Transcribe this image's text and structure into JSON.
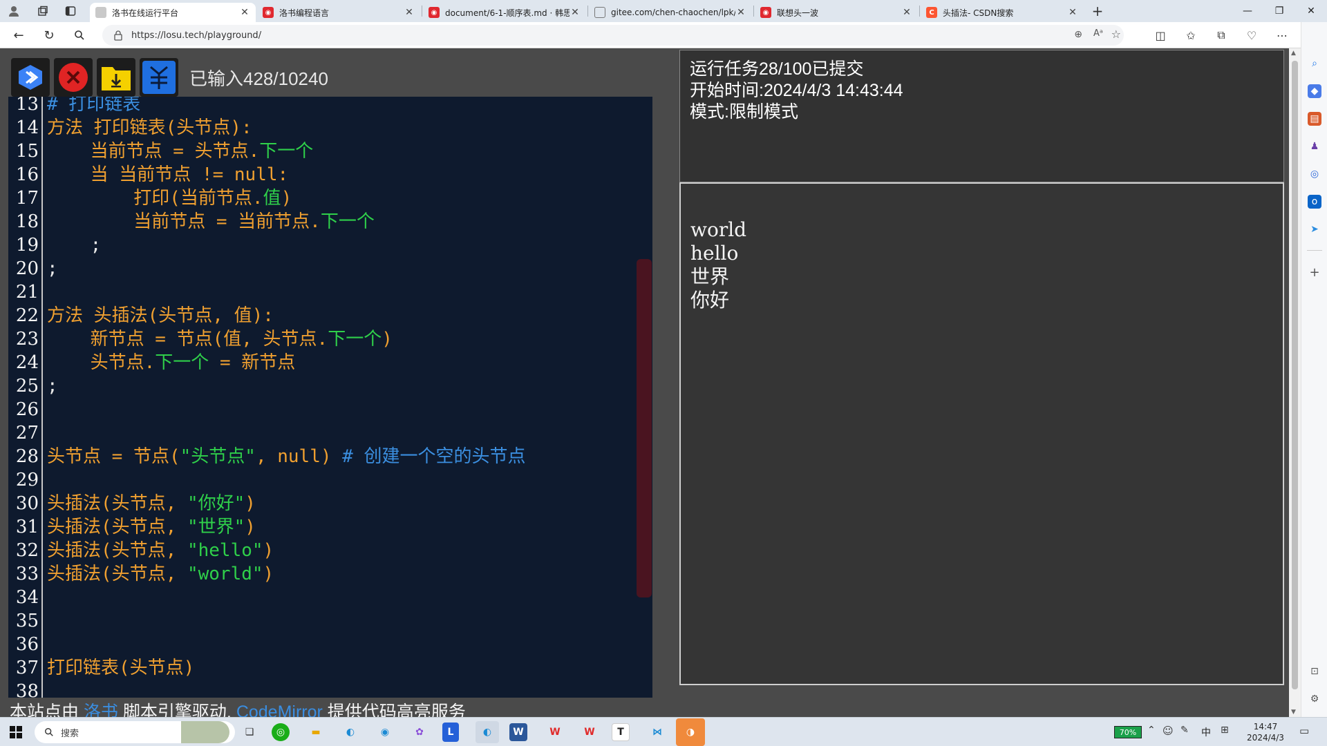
{
  "browser": {
    "tabs": [
      {
        "title": "洛书在线运行平台",
        "active": true,
        "favicon": "page-icon"
      },
      {
        "title": "洛书编程语言",
        "active": false,
        "favicon": "weibo-icon"
      },
      {
        "title": "document/6-1-顺序表.md · 韩思",
        "active": false,
        "favicon": "weibo-icon"
      },
      {
        "title": "gitee.com/chen-chaochen/lpk/ra",
        "active": false,
        "favicon": "doc-icon"
      },
      {
        "title": "联想头一波",
        "active": false,
        "favicon": "weibo-icon"
      },
      {
        "title": "头插法- CSDN搜索",
        "active": false,
        "favicon": "csdn-icon"
      }
    ],
    "url": "https://losu.tech/playground/"
  },
  "toolbar": {
    "counter_text": "已输入428/10240"
  },
  "editor": {
    "lines": [
      {
        "n": "13",
        "tokens": [
          {
            "t": "# 打印链表",
            "c": "cm"
          }
        ]
      },
      {
        "n": "14",
        "tokens": [
          {
            "t": "方法 打印链表(头节点):",
            "c": "kw"
          }
        ]
      },
      {
        "n": "15",
        "tokens": [
          {
            "t": "    当前节点 = 头节点.",
            "c": "id"
          },
          {
            "t": "下一个",
            "c": "pr"
          }
        ]
      },
      {
        "n": "16",
        "tokens": [
          {
            "t": "    当 当前节点 != ",
            "c": "id"
          },
          {
            "t": "null",
            "c": "nu"
          },
          {
            "t": ":",
            "c": "id"
          }
        ]
      },
      {
        "n": "17",
        "tokens": [
          {
            "t": "        打印(当前节点.",
            "c": "id"
          },
          {
            "t": "值",
            "c": "pr"
          },
          {
            "t": ")",
            "c": "id"
          }
        ]
      },
      {
        "n": "18",
        "tokens": [
          {
            "t": "        当前节点 = 当前节点.",
            "c": "id"
          },
          {
            "t": "下一个",
            "c": "pr"
          }
        ]
      },
      {
        "n": "19",
        "tokens": [
          {
            "t": "    ;",
            "c": "op"
          }
        ]
      },
      {
        "n": "20",
        "tokens": [
          {
            "t": ";",
            "c": "op"
          }
        ]
      },
      {
        "n": "21",
        "tokens": []
      },
      {
        "n": "22",
        "tokens": [
          {
            "t": "方法 头插法(头节点, 值):",
            "c": "kw"
          }
        ]
      },
      {
        "n": "23",
        "tokens": [
          {
            "t": "    新节点 = 节点(值, 头节点.",
            "c": "id"
          },
          {
            "t": "下一个",
            "c": "pr"
          },
          {
            "t": ")",
            "c": "id"
          }
        ]
      },
      {
        "n": "24",
        "tokens": [
          {
            "t": "    头节点.",
            "c": "id"
          },
          {
            "t": "下一个",
            "c": "pr"
          },
          {
            "t": " = 新节点",
            "c": "id"
          }
        ]
      },
      {
        "n": "25",
        "tokens": [
          {
            "t": ";",
            "c": "op"
          }
        ]
      },
      {
        "n": "26",
        "tokens": []
      },
      {
        "n": "27",
        "tokens": []
      },
      {
        "n": "28",
        "tokens": [
          {
            "t": "头节点 = 节点(",
            "c": "id"
          },
          {
            "t": "\"头节点\"",
            "c": "st"
          },
          {
            "t": ", null) ",
            "c": "id"
          },
          {
            "t": "# 创建一个空的头节点",
            "c": "cm"
          }
        ]
      },
      {
        "n": "29",
        "tokens": []
      },
      {
        "n": "30",
        "tokens": [
          {
            "t": "头插法(头节点, ",
            "c": "id"
          },
          {
            "t": "\"你好\"",
            "c": "st"
          },
          {
            "t": ")",
            "c": "id"
          }
        ]
      },
      {
        "n": "31",
        "tokens": [
          {
            "t": "头插法(头节点, ",
            "c": "id"
          },
          {
            "t": "\"世界\"",
            "c": "st"
          },
          {
            "t": ")",
            "c": "id"
          }
        ]
      },
      {
        "n": "32",
        "tokens": [
          {
            "t": "头插法(头节点, ",
            "c": "id"
          },
          {
            "t": "\"hello\"",
            "c": "st"
          },
          {
            "t": ")",
            "c": "id"
          }
        ]
      },
      {
        "n": "33",
        "tokens": [
          {
            "t": "头插法(头节点, ",
            "c": "id"
          },
          {
            "t": "\"world\"",
            "c": "st"
          },
          {
            "t": ")",
            "c": "id"
          }
        ]
      },
      {
        "n": "34",
        "tokens": []
      },
      {
        "n": "35",
        "tokens": []
      },
      {
        "n": "36",
        "tokens": []
      },
      {
        "n": "37",
        "tokens": [
          {
            "t": "打印链表(头节点)",
            "c": "id"
          }
        ]
      },
      {
        "n": "38",
        "tokens": []
      }
    ]
  },
  "credits": {
    "prefix": "本站点由 ",
    "link1": "洛书",
    "middle": " 脚本引擎驱动, ",
    "link2": "CodeMirror",
    "suffix": " 提供代码高亮服务"
  },
  "info": {
    "line1": "运行任务28/100已提交",
    "line2": "开始时间:2024/4/3 14:43:44",
    "line3": "模式:限制模式"
  },
  "output": {
    "lines": [
      "world",
      "hello",
      "世界",
      "你好"
    ]
  },
  "taskbar": {
    "search_placeholder": "搜索",
    "battery": "70%",
    "ime": "中",
    "time": "14:47",
    "date": "2024/4/3"
  },
  "colors": {
    "editor_bg": "#0e1a2e",
    "keyword": "#f0a030",
    "property": "#2fd04a",
    "comment": "#3b8fe0",
    "run_button": "#3b82f6",
    "stop_button": "#e02424",
    "save_button": "#f5d000"
  }
}
